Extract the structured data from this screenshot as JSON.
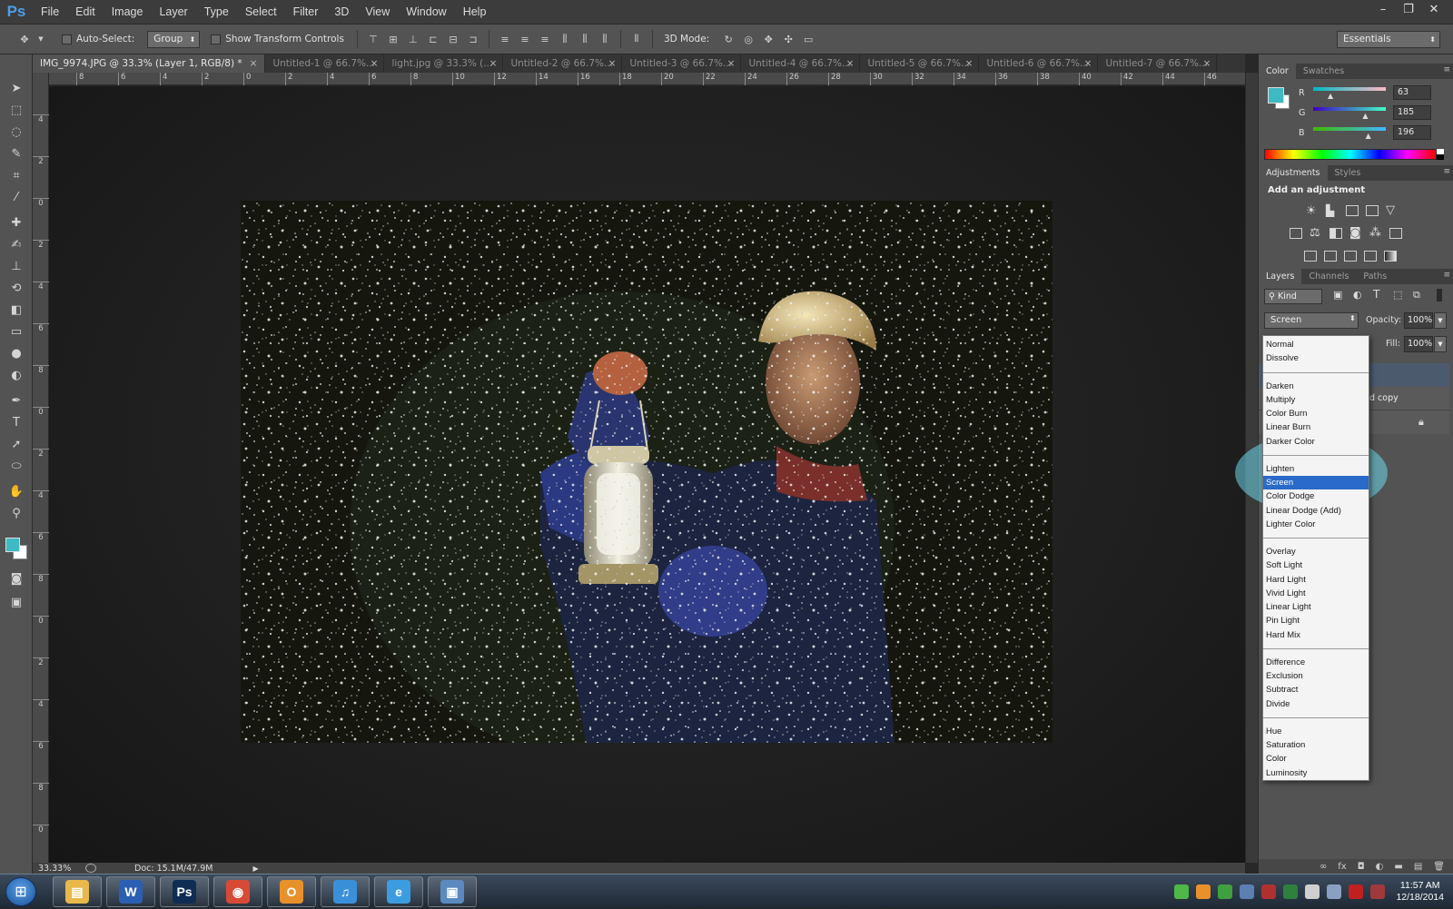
{
  "app": {
    "logo": "Ps"
  },
  "menu": [
    "File",
    "Edit",
    "Image",
    "Layer",
    "Type",
    "Select",
    "Filter",
    "3D",
    "View",
    "Window",
    "Help"
  ],
  "window_controls": {
    "minimize": "–",
    "restore": "❐",
    "close": "✕"
  },
  "options": {
    "auto_select_label": "Auto-Select:",
    "auto_select_value": "Group",
    "show_transform_label": "Show Transform Controls",
    "mode_3d_label": "3D Mode:",
    "workspace": "Essentials"
  },
  "tabs": [
    {
      "label": "IMG_9974.JPG @ 33.3% (Layer 1, RGB/8) *",
      "active": true
    },
    {
      "label": "Untitled-1 @ 66.7%..."
    },
    {
      "label": "light.jpg @ 33.3% (..."
    },
    {
      "label": "Untitled-2 @ 66.7%..."
    },
    {
      "label": "Untitled-3 @ 66.7%..."
    },
    {
      "label": "Untitled-4 @ 66.7%..."
    },
    {
      "label": "Untitled-5 @ 66.7%..."
    },
    {
      "label": "Untitled-6 @ 66.7%..."
    },
    {
      "label": "Untitled-7 @ 66.7%..."
    }
  ],
  "tab_close": "×",
  "hruler_labels": [
    "8",
    "6",
    "4",
    "2",
    "0",
    "2",
    "4",
    "6",
    "8",
    "10",
    "12",
    "14",
    "16",
    "18",
    "20",
    "22",
    "24",
    "26",
    "28",
    "30",
    "32",
    "34",
    "36",
    "38",
    "40",
    "42",
    "44",
    "46"
  ],
  "vruler_labels": [
    "4",
    "2",
    "0",
    "2",
    "4",
    "6",
    "8",
    "0",
    "2",
    "4",
    "6",
    "8",
    "0",
    "2",
    "4",
    "6",
    "8",
    "0"
  ],
  "status": {
    "zoom": "33.33%",
    "doc": "Doc: 15.1M/47.9M"
  },
  "color_panel": {
    "tabs": [
      "Color",
      "Swatches"
    ],
    "r_label": "R",
    "g_label": "G",
    "b_label": "B",
    "r": "63",
    "g": "185",
    "b": "196",
    "r_level": 0.25,
    "g_level": 0.73,
    "b_level": 0.77,
    "foreground": "#3fb9c4"
  },
  "adjustments_panel": {
    "tabs": [
      "Adjustments",
      "Styles"
    ],
    "heading": "Add an adjustment"
  },
  "layers_panel": {
    "tabs": [
      "Layers",
      "Channels",
      "Paths"
    ],
    "kind_label": "Kind",
    "blend_mode": "Screen",
    "opacity_label": "Opacity:",
    "opacity": "100%",
    "fill_label": "Fill:",
    "fill": "100%",
    "layer_partial": "d copy"
  },
  "blend_modes": [
    {
      "group": [
        "Normal",
        "Dissolve"
      ]
    },
    {
      "group": [
        "Darken",
        "Multiply",
        "Color Burn",
        "Linear Burn",
        "Darker Color"
      ]
    },
    {
      "group": [
        "Lighten",
        "Screen",
        "Color Dodge",
        "Linear Dodge (Add)",
        "Lighter Color"
      ]
    },
    {
      "group": [
        "Overlay",
        "Soft Light",
        "Hard Light",
        "Vivid Light",
        "Linear Light",
        "Pin Light",
        "Hard Mix"
      ]
    },
    {
      "group": [
        "Difference",
        "Exclusion",
        "Subtract",
        "Divide"
      ]
    },
    {
      "group": [
        "Hue",
        "Saturation",
        "Color",
        "Luminosity"
      ]
    }
  ],
  "blend_selected": "Screen",
  "taskbar": {
    "apps": [
      {
        "name": "explorer-app",
        "glyph": "▤",
        "color": "#e8b84a"
      },
      {
        "name": "word-app",
        "glyph": "W",
        "color": "#2b5fb4"
      },
      {
        "name": "photoshop-app",
        "glyph": "Ps",
        "color": "#0f2d52"
      },
      {
        "name": "chrome-app",
        "glyph": "◉",
        "color": "#d84a36"
      },
      {
        "name": "outlook-app",
        "glyph": "O",
        "color": "#e8912b"
      },
      {
        "name": "itunes-app",
        "glyph": "♫",
        "color": "#3a8fd9"
      },
      {
        "name": "ie-app",
        "glyph": "e",
        "color": "#3b9de0"
      },
      {
        "name": "media-app",
        "glyph": "▣",
        "color": "#5a8ac0"
      }
    ],
    "time": "11:57 AM",
    "date": "12/18/2014"
  }
}
